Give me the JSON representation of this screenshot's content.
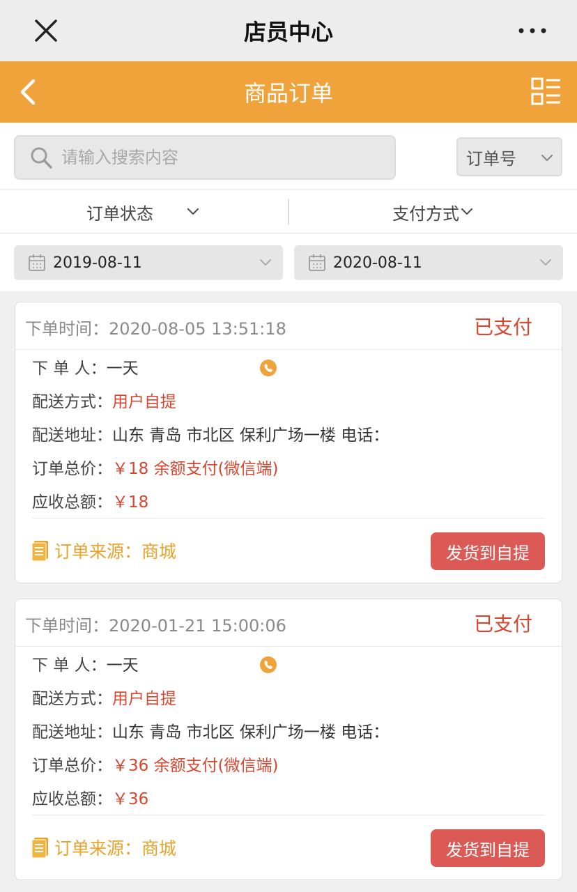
{
  "topbar": {
    "title": "店员中心"
  },
  "header": {
    "title": "商品订单"
  },
  "search": {
    "placeholder": "请输入搜索内容",
    "value": "",
    "select_value": "订单号"
  },
  "filters": {
    "order_status": "订单状态",
    "payment_method": "支付方式"
  },
  "dates": {
    "start": "2019-08-11",
    "end": "2020-08-11"
  },
  "labels": {
    "order_time": "下单时间：",
    "orderer": "下 单 人：",
    "delivery_method": "配送方式：",
    "delivery_address": "配送地址：",
    "order_total": "订单总价：",
    "receivable": "应收总额：",
    "order_source": "订单来源：",
    "ship_button": "发货到自提"
  },
  "orders": [
    {
      "time": "2020-08-05 13:51:18",
      "status": "已支付",
      "orderer": "一天",
      "delivery_method": "用户自提",
      "address": "山东 青岛 市北区 保利广场一楼 电话：",
      "total": "￥18 余额支付(微信端)",
      "receivable": "￥18",
      "source": "商城"
    },
    {
      "time": "2020-01-21 15:00:06",
      "status": "已支付",
      "orderer": "一天",
      "delivery_method": "用户自提",
      "address": "山东 青岛 市北区 保利广场一楼 电话：",
      "total": "￥36 余额支付(微信端)",
      "receivable": "￥36",
      "source": "商城"
    }
  ],
  "colors": {
    "header_bg": "#f0a33a",
    "status_red": "#d9452e",
    "button_red": "#dc5a55",
    "source_orange": "#e8a32c",
    "phone_icon": "#f0a33a"
  },
  "icons": {
    "close": "close-icon",
    "more": "more-dots-icon",
    "back": "back-chevron-icon",
    "menu": "list-menu-icon",
    "search": "search-icon",
    "calendar": "calendar-icon",
    "phone": "phone-icon",
    "source": "document-icon"
  }
}
